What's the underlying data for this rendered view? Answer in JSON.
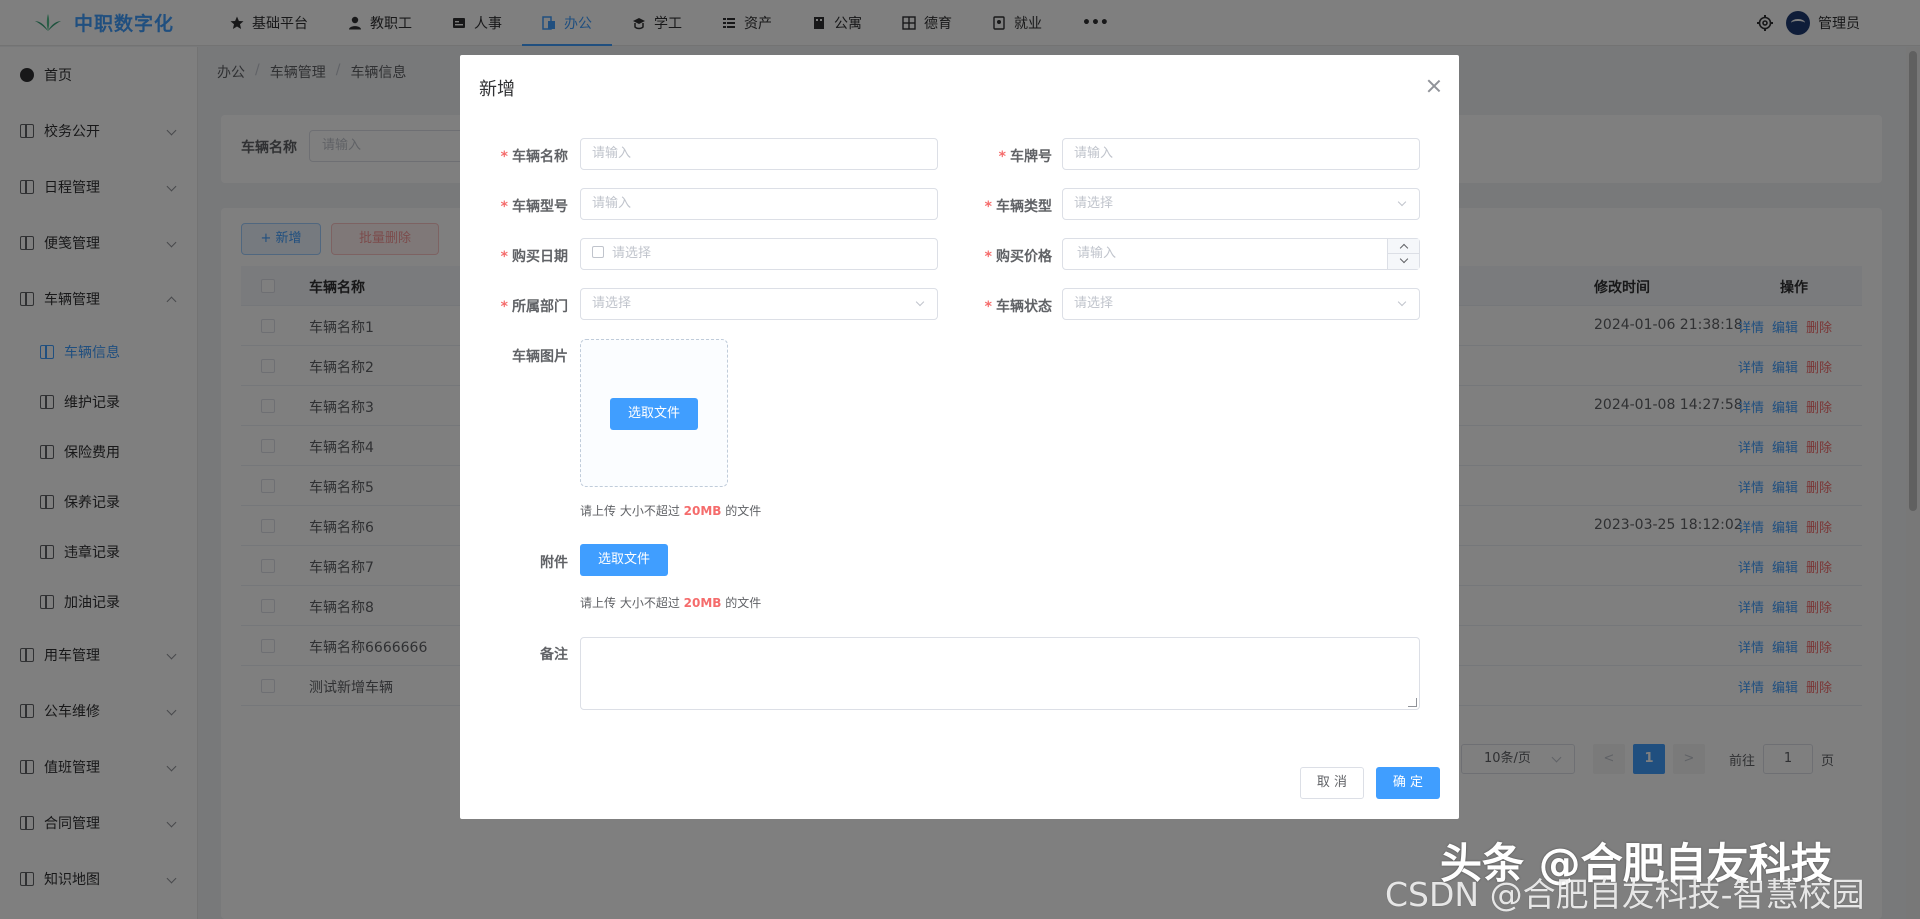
{
  "brand": {
    "name": "中职数字化",
    "accent": "#409eff"
  },
  "topnav": [
    {
      "label": "基础平台",
      "icon": "star-icon"
    },
    {
      "label": "教职工",
      "icon": "user-icon"
    },
    {
      "label": "人事",
      "icon": "id-card-icon"
    },
    {
      "label": "办公",
      "icon": "office-icon",
      "active": true
    },
    {
      "label": "学工",
      "icon": "student-icon"
    },
    {
      "label": "资产",
      "icon": "asset-icon"
    },
    {
      "label": "公寓",
      "icon": "apartment-icon"
    },
    {
      "label": "德育",
      "icon": "moral-icon"
    },
    {
      "label": "就业",
      "icon": "job-icon"
    }
  ],
  "header": {
    "more": "•••",
    "username": "管理员"
  },
  "sidebar": {
    "home": "首页",
    "groups": [
      {
        "label": "校务公开"
      },
      {
        "label": "日程管理"
      },
      {
        "label": "便笺管理"
      },
      {
        "label": "车辆管理",
        "expanded": true
      }
    ],
    "sub_items": [
      {
        "label": "车辆信息",
        "active": true
      },
      {
        "label": "维护记录"
      },
      {
        "label": "保险费用"
      },
      {
        "label": "保养记录"
      },
      {
        "label": "违章记录"
      },
      {
        "label": "加油记录"
      }
    ],
    "groups_after": [
      {
        "label": "用车管理"
      },
      {
        "label": "公车维修"
      },
      {
        "label": "值班管理"
      },
      {
        "label": "合同管理"
      },
      {
        "label": "知识地图"
      }
    ]
  },
  "breadcrumb": [
    "办公",
    "车辆管理",
    "车辆信息"
  ],
  "search": {
    "label": "车辆名称",
    "placeholder": "请输入"
  },
  "toolbar": {
    "add_label": "+ 新增",
    "batch_delete_label": "批量删除"
  },
  "table": {
    "columns": {
      "name": "车辆名称",
      "modified": "修改时间",
      "ops": "操作"
    },
    "ops": {
      "detail": "详情",
      "edit": "编辑",
      "delete": "删除"
    },
    "rows": [
      {
        "name": "车辆名称1",
        "modified": "2024-01-06 21:38:18"
      },
      {
        "name": "车辆名称2",
        "modified": ""
      },
      {
        "name": "车辆名称3",
        "modified": "2024-01-08 14:27:58"
      },
      {
        "name": "车辆名称4",
        "modified": ""
      },
      {
        "name": "车辆名称5",
        "modified": ""
      },
      {
        "name": "车辆名称6",
        "modified": "2023-03-25 18:12:02"
      },
      {
        "name": "车辆名称7",
        "modified": ""
      },
      {
        "name": "车辆名称8",
        "modified": ""
      },
      {
        "name": "车辆名称6666666",
        "modified": ""
      },
      {
        "name": "测试新增车辆",
        "modified": ""
      }
    ]
  },
  "pagination": {
    "page_size": "10条/页",
    "prev": "<",
    "current": "1",
    "next": ">",
    "goto_label": "前往",
    "goto_value": "1",
    "page_suffix": "页"
  },
  "dialog": {
    "title": "新增",
    "fields": {
      "vehicle_name": {
        "label": "车辆名称",
        "placeholder": "请输入",
        "required": true
      },
      "plate": {
        "label": "车牌号",
        "placeholder": "请输入",
        "required": true
      },
      "model": {
        "label": "车辆型号",
        "placeholder": "请输入",
        "required": true
      },
      "type": {
        "label": "车辆类型",
        "placeholder": "请选择",
        "required": true
      },
      "purchase_date": {
        "label": "购买日期",
        "placeholder": "请选择",
        "required": true
      },
      "price": {
        "label": "购买价格",
        "placeholder": "请输入",
        "required": true
      },
      "department": {
        "label": "所属部门",
        "placeholder": "请选择",
        "required": true
      },
      "status": {
        "label": "车辆状态",
        "placeholder": "请选择",
        "required": true
      }
    },
    "image": {
      "label": "车辆图片",
      "button": "选取文件",
      "hint_prefix": "请上传 大小不超过",
      "hint_size": "20MB",
      "hint_suffix": "的文件"
    },
    "attachment": {
      "label": "附件",
      "button": "选取文件",
      "hint_prefix": "请上传 大小不超过",
      "hint_size": "20MB",
      "hint_suffix": "的文件"
    },
    "remark": {
      "label": "备注"
    },
    "cancel": "取 消",
    "confirm": "确 定"
  },
  "watermark": {
    "line1": "头条 @合肥自友科技",
    "line2": "CSDN @合肥自友科技-智慧校园"
  }
}
